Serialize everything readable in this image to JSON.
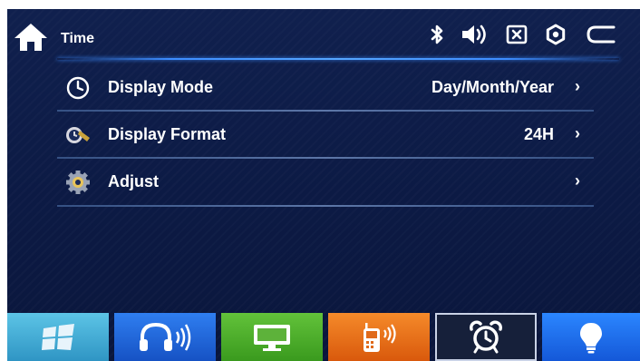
{
  "header": {
    "title": "Time",
    "icons": [
      "home-icon",
      "bluetooth-icon",
      "volume-icon",
      "close-box-icon",
      "settings-icon",
      "back-icon"
    ]
  },
  "settings": [
    {
      "icon": "clock-icon",
      "label": "Display Mode",
      "value": "Day/Month/Year",
      "chevron": "›"
    },
    {
      "icon": "format-icon",
      "label": "Display Format",
      "value": "24H",
      "chevron": "›"
    },
    {
      "icon": "gear-icon",
      "label": "Adjust",
      "value": "",
      "chevron": "›"
    }
  ],
  "dock": {
    "tabs": [
      {
        "name": "windows-icon",
        "color": "#3aa7cf"
      },
      {
        "name": "bluetooth-audio-icon",
        "color": "#1b5ed3"
      },
      {
        "name": "display-icon",
        "color": "#4fa928"
      },
      {
        "name": "phone-icon",
        "color": "#e56b14"
      },
      {
        "name": "alarm-clock-icon",
        "color": "#16203a",
        "selected": true
      },
      {
        "name": "light-bulb-icon",
        "color": "#1c6cf0"
      }
    ]
  }
}
